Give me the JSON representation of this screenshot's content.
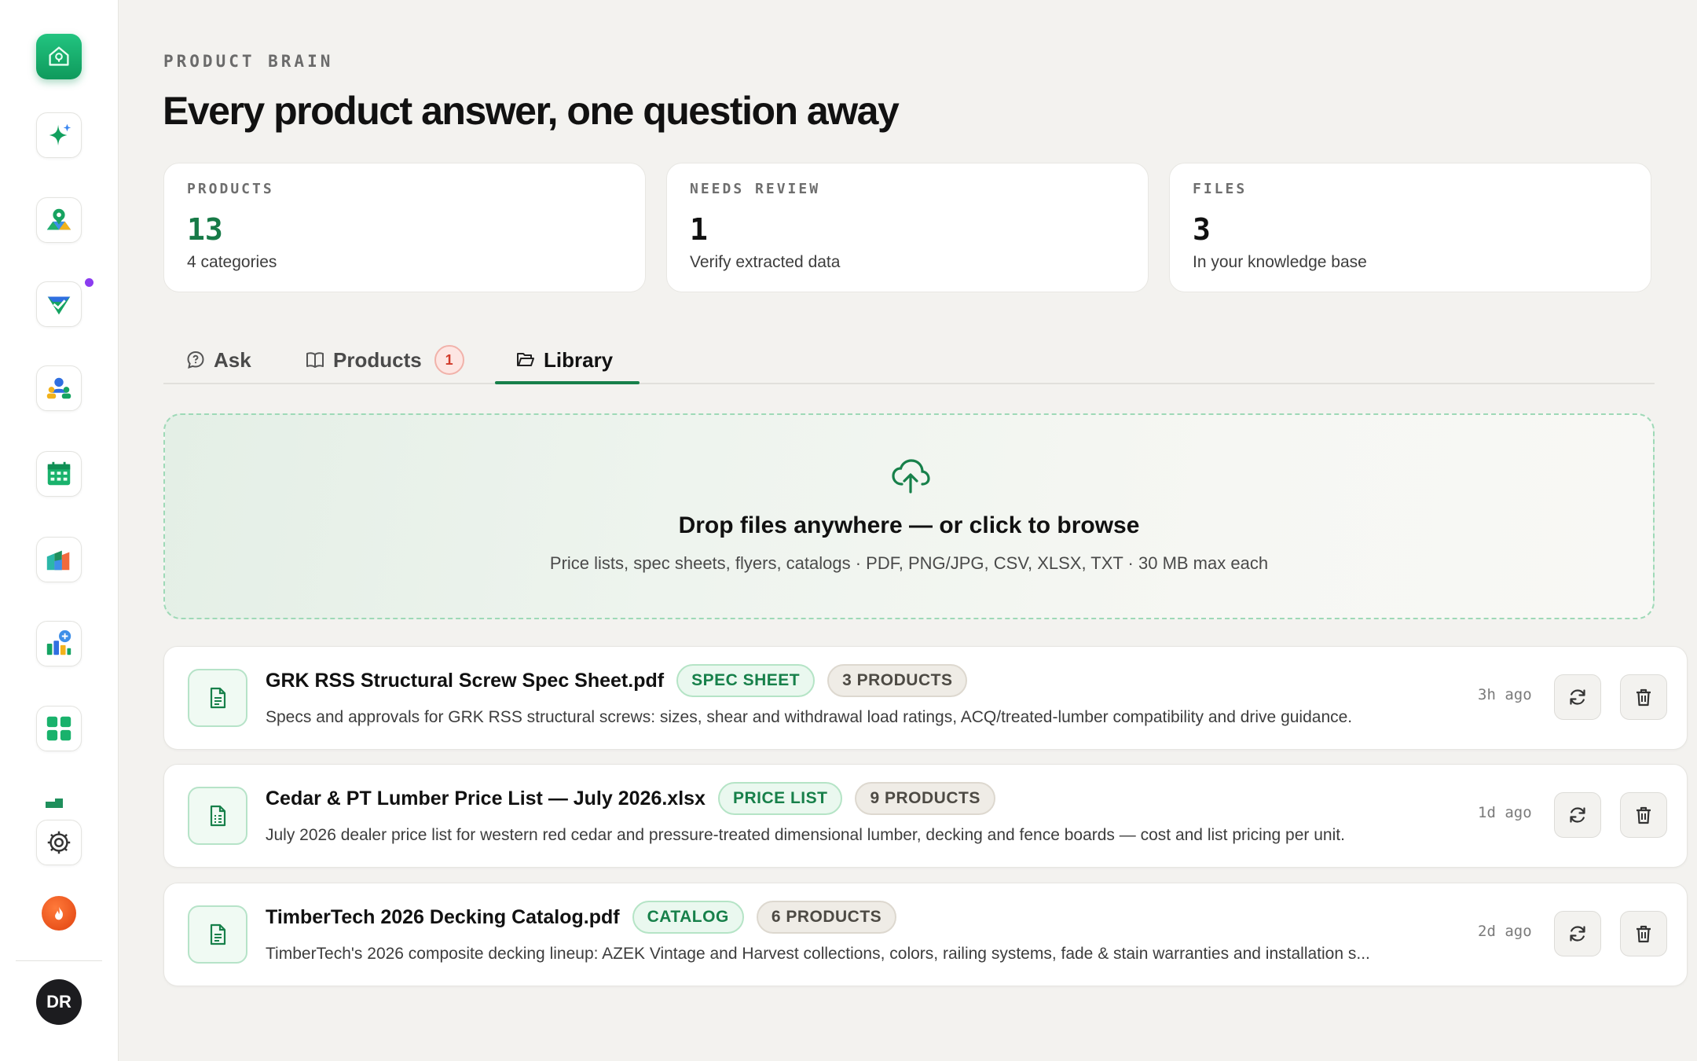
{
  "sidebar": {
    "icons": [
      "home-pin-icon",
      "sparkle-icon",
      "map-pin-icon",
      "shield-check-icon",
      "people-icon",
      "calendar-icon",
      "bar-chart-icon",
      "chart-chat-icon",
      "grid-icon",
      "settings-icon",
      "flame-icon"
    ],
    "avatar_initials": "DR",
    "accent": "#12a866",
    "notification_color": "#8b3cf0"
  },
  "header": {
    "eyebrow": "PRODUCT BRAIN",
    "title": "Every product answer, one question away"
  },
  "stats": [
    {
      "label": "PRODUCTS",
      "value": "13",
      "sub": "4 categories"
    },
    {
      "label": "NEEDS REVIEW",
      "value": "1",
      "sub": "Verify extracted data"
    },
    {
      "label": "FILES",
      "value": "3",
      "sub": "In your knowledge base"
    }
  ],
  "tabs": {
    "ask": "Ask",
    "products": "Products",
    "products_badge": "1",
    "library": "Library",
    "active": "Library"
  },
  "dropzone": {
    "title": "Drop files anywhere — or click to browse",
    "subtitle": "Price lists, spec sheets, flyers, catalogs · PDF, PNG/JPG, CSV, XLSX, TXT · 30 MB max each"
  },
  "files": [
    {
      "name": "GRK RSS Structural Screw Spec Sheet.pdf",
      "type": "SPEC SHEET",
      "count": "3 PRODUCTS",
      "description": "Specs and approvals for GRK RSS structural screws: sizes, shear and withdrawal load ratings, ACQ/treated-lumber compatibility and drive guidance.",
      "time": "3h ago"
    },
    {
      "name": "Cedar & PT Lumber Price List — July 2026.xlsx",
      "type": "PRICE LIST",
      "count": "9 PRODUCTS",
      "description": "July 2026 dealer price list for western red cedar and pressure-treated dimensional lumber, decking and fence boards — cost and list pricing per unit.",
      "time": "1d ago"
    },
    {
      "name": "TimberTech 2026 Decking Catalog.pdf",
      "type": "CATALOG",
      "count": "6 PRODUCTS",
      "description": "TimberTech's 2026 composite decking lineup: AZEK Vintage and Harvest collections, colors, railing systems, fade & stain warranties and installation s...",
      "time": "2d ago"
    }
  ]
}
